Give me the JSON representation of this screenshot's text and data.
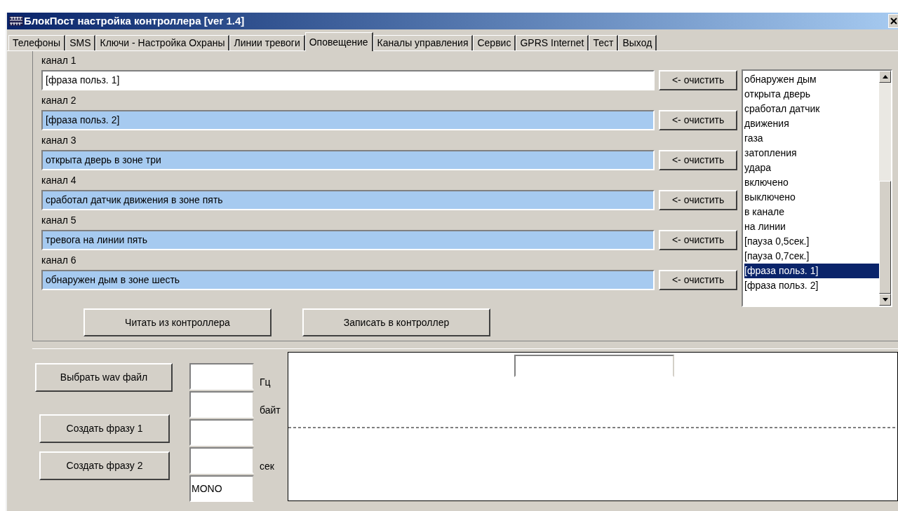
{
  "window": {
    "title": "БлокПост настройка контроллера [ver 1.4]"
  },
  "tabs": [
    {
      "label": "Телефоны",
      "selected": false
    },
    {
      "label": "SMS",
      "selected": false
    },
    {
      "label": "Ключи - Настройка Охраны",
      "selected": false
    },
    {
      "label": "Линии тревоги",
      "selected": false
    },
    {
      "label": "Оповещение",
      "selected": true
    },
    {
      "label": "Каналы управления",
      "selected": false
    },
    {
      "label": "Сервис",
      "selected": false
    },
    {
      "label": "GPRS Internet",
      "selected": false
    },
    {
      "label": "Тест",
      "selected": false
    },
    {
      "label": "Выход",
      "selected": false
    }
  ],
  "channels": [
    {
      "label": "канал 1",
      "value": "[фраза польз. 1]",
      "focused": true,
      "button": "<- очистить"
    },
    {
      "label": "канал 2",
      "value": "[фраза польз. 2]",
      "focused": false,
      "button": "<- очистить"
    },
    {
      "label": "канал 3",
      "value": "открыта дверь в зоне три",
      "focused": false,
      "button": "<- очистить"
    },
    {
      "label": "канал 4",
      "value": "сработал датчик движения в зоне пять",
      "focused": false,
      "button": "<- очистить"
    },
    {
      "label": "канал 5",
      "value": "тревога на линии пять",
      "focused": false,
      "button": "<- очистить"
    },
    {
      "label": "канал 6",
      "value": "обнаружен дым в зоне шесть",
      "focused": false,
      "button": "<- очистить"
    }
  ],
  "phrase_list": [
    {
      "label": "обнаружен дым",
      "selected": false
    },
    {
      "label": "открыта дверь",
      "selected": false
    },
    {
      "label": "сработал датчик",
      "selected": false
    },
    {
      "label": "движения",
      "selected": false
    },
    {
      "label": "газа",
      "selected": false
    },
    {
      "label": "затопления",
      "selected": false
    },
    {
      "label": "удара",
      "selected": false
    },
    {
      "label": "включено",
      "selected": false
    },
    {
      "label": "выключено",
      "selected": false
    },
    {
      "label": "в канале",
      "selected": false
    },
    {
      "label": "на линии",
      "selected": false
    },
    {
      "label": "[пауза 0,5сек.]",
      "selected": false
    },
    {
      "label": "[пауза 0,7сек.]",
      "selected": false
    },
    {
      "label": "[фраза польз. 1]",
      "selected": true
    },
    {
      "label": "[фраза польз. 2]",
      "selected": false
    }
  ],
  "controller_buttons": [
    "Читать из контроллера",
    "Записать в контроллер"
  ],
  "sound": {
    "buttons": [
      "Выбрать wav файл",
      "Создать фразу 1",
      "Создать фразу 2"
    ],
    "fields": [
      {
        "kind": "input",
        "unit": "Гц"
      },
      {
        "kind": "input",
        "unit": "байт"
      },
      {
        "kind": "input"
      },
      {
        "kind": "input",
        "unit": "сек"
      },
      {
        "kind": "input",
        "value": "MONO"
      }
    ]
  }
}
